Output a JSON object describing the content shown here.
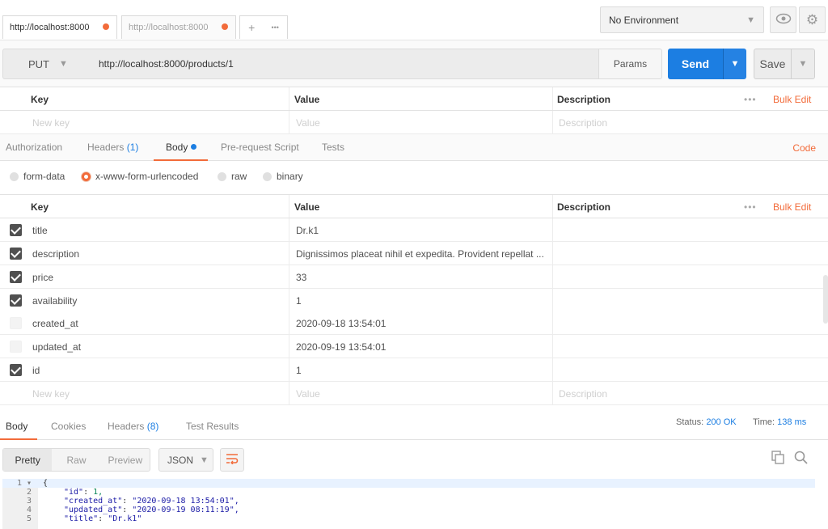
{
  "tabs": [
    {
      "url": "http://localhost:8000"
    },
    {
      "url": "http://localhost:8000"
    }
  ],
  "tab_controls": {
    "add": "+",
    "more": "•••"
  },
  "environment": {
    "selected": "No Environment"
  },
  "request": {
    "method": "PUT",
    "url": "http://localhost:8000/products/1",
    "params_label": "Params",
    "send_label": "Send",
    "save_label": "Save"
  },
  "params_table": {
    "headers": {
      "key": "Key",
      "value": "Value",
      "description": "Description"
    },
    "more": "•••",
    "bulk_edit": "Bulk Edit",
    "placeholders": {
      "key": "New key",
      "value": "Value",
      "description": "Description"
    }
  },
  "request_tabs": {
    "authorization": "Authorization",
    "headers": "Headers",
    "headers_count": "(1)",
    "body": "Body",
    "prerequest": "Pre-request Script",
    "tests": "Tests",
    "code": "Code"
  },
  "body_types": [
    {
      "label": "form-data",
      "selected": false
    },
    {
      "label": "x-www-form-urlencoded",
      "selected": true
    },
    {
      "label": "raw",
      "selected": false
    },
    {
      "label": "binary",
      "selected": false
    }
  ],
  "body_table": {
    "headers": {
      "key": "Key",
      "value": "Value",
      "description": "Description"
    },
    "more": "•••",
    "bulk_edit": "Bulk Edit",
    "rows": [
      {
        "key": "title",
        "value": "Dr.k1",
        "checked": true
      },
      {
        "key": "description",
        "value": "Dignissimos placeat nihil et expedita. Provident repellat ...",
        "checked": true
      },
      {
        "key": "price",
        "value": "33",
        "checked": true
      },
      {
        "key": "availability",
        "value": "1",
        "checked": true
      },
      {
        "key": "created_at",
        "value": "2020-09-18 13:54:01",
        "checked": false
      },
      {
        "key": "updated_at",
        "value": "2020-09-19 13:54:01",
        "checked": false
      },
      {
        "key": "id",
        "value": "1",
        "checked": true
      }
    ],
    "placeholders": {
      "key": "New key",
      "value": "Value",
      "description": "Description"
    }
  },
  "response_tabs": {
    "body": "Body",
    "cookies": "Cookies",
    "headers": "Headers",
    "headers_count": "(8)",
    "test_results": "Test Results"
  },
  "response_status": {
    "status_label": "Status:",
    "status_value": "200 OK",
    "time_label": "Time:",
    "time_value": "138 ms"
  },
  "response_view": {
    "modes": [
      "Pretty",
      "Raw",
      "Preview"
    ],
    "active_mode": "Pretty",
    "format": "JSON"
  },
  "response_code": [
    {
      "line": "1 ▾",
      "text": "{"
    },
    {
      "line": "2",
      "key": "\"id\"",
      "value": "1,",
      "value_type": "num"
    },
    {
      "line": "3",
      "key": "\"created_at\"",
      "value": "\"2020-09-18 13:54:01\",",
      "value_type": "str"
    },
    {
      "line": "4",
      "key": "\"updated_at\"",
      "value": "\"2020-09-19 08:11:19\",",
      "value_type": "str"
    },
    {
      "line": "5",
      "key": "\"title\"",
      "value": "\"Dr.k1\"",
      "value_type": "str"
    }
  ],
  "colors": {
    "accent": "#f26b3a",
    "primary": "#1c7ee2",
    "checkbox": "#505050"
  }
}
